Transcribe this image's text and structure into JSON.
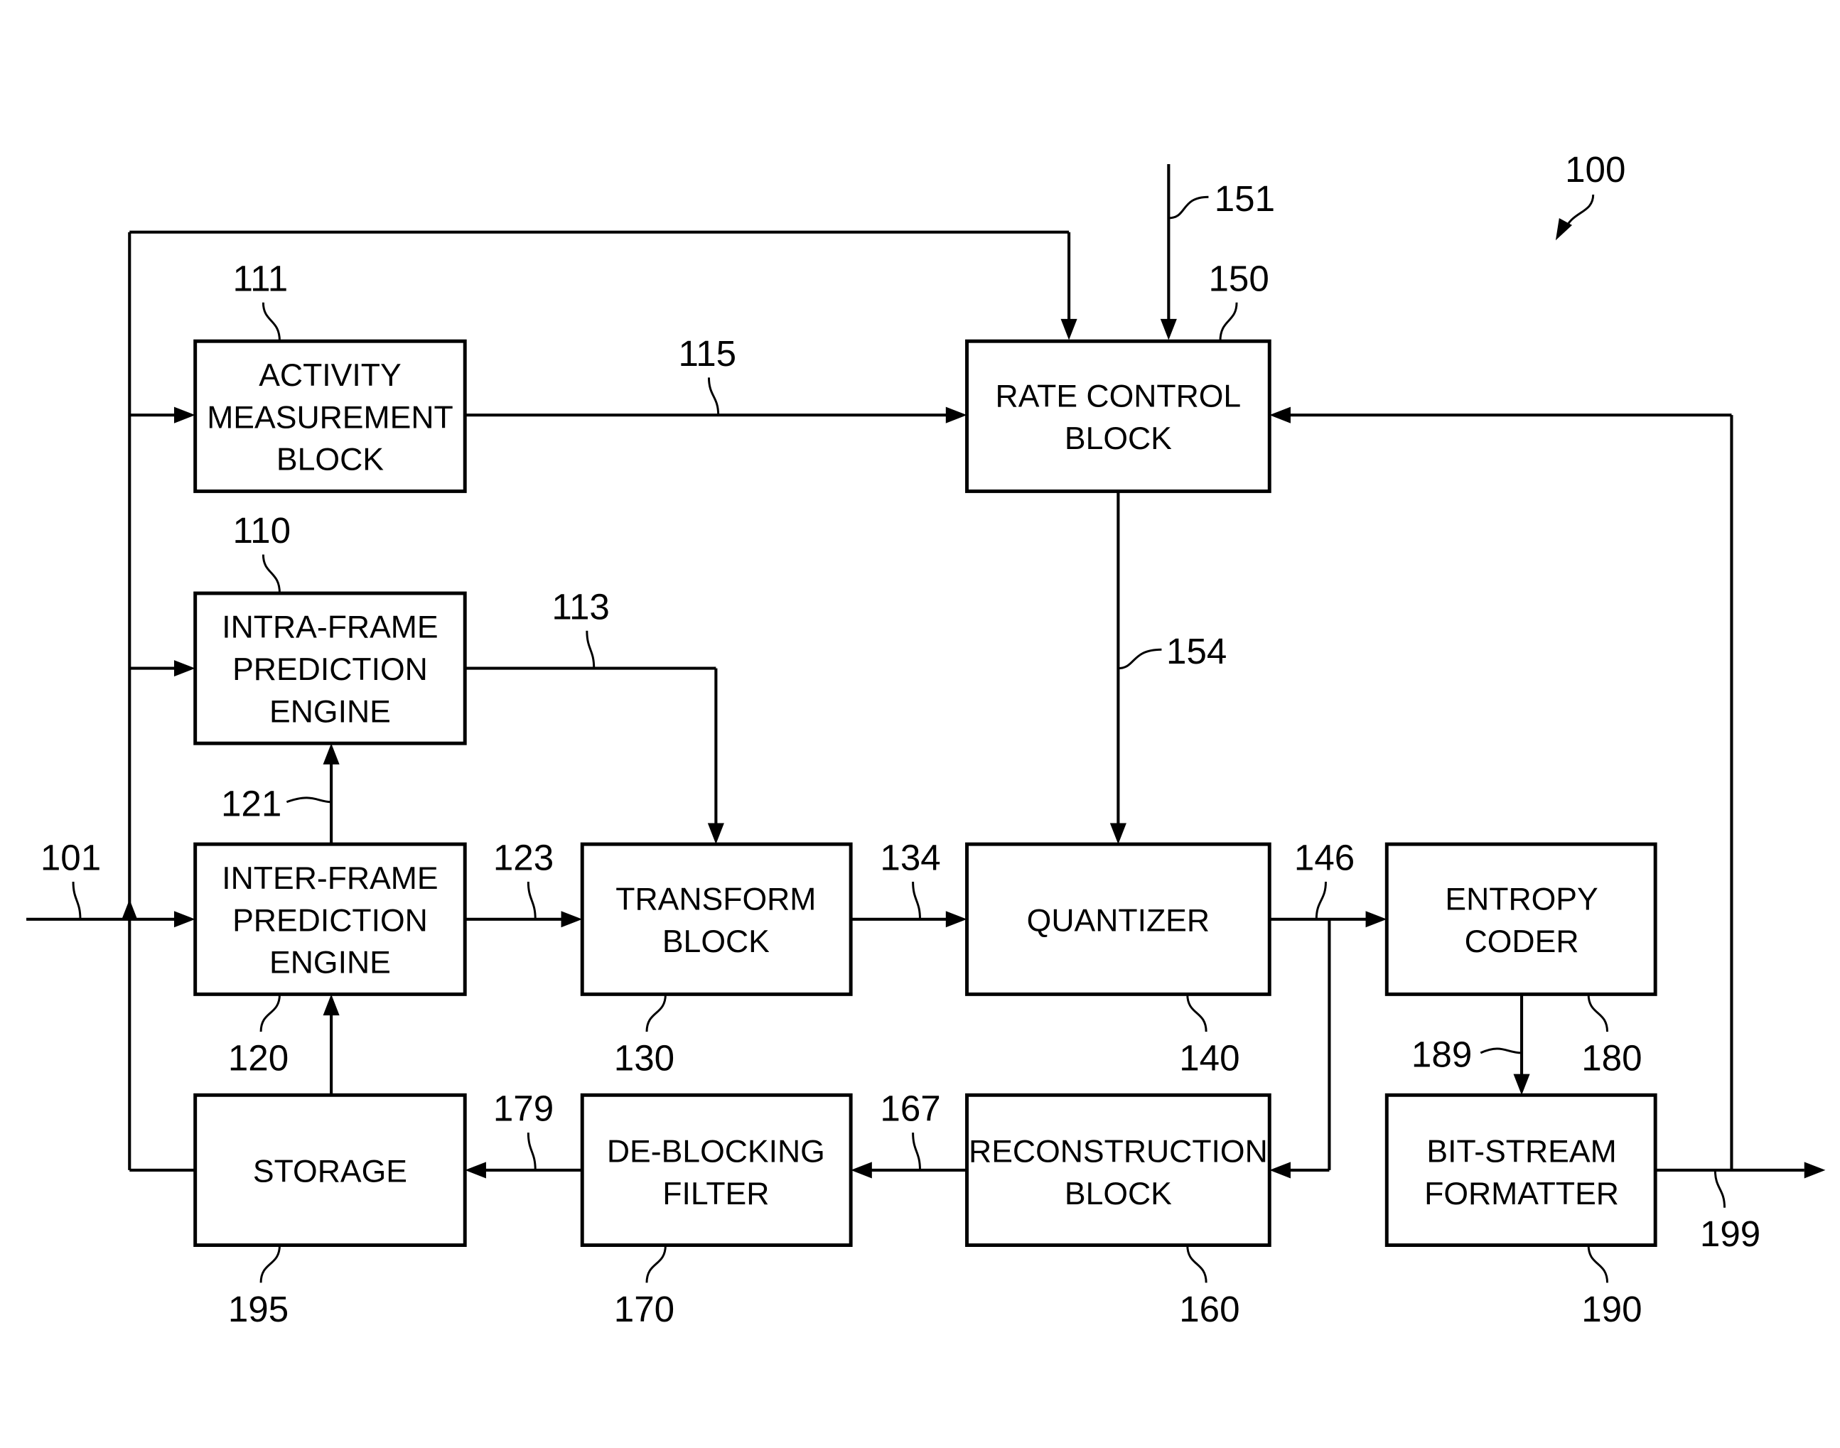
{
  "figure": {
    "ref": "100",
    "colors": {
      "line": "#000000",
      "background": "#ffffff"
    }
  },
  "blocks": {
    "activity": {
      "ref": "111",
      "lines": [
        "ACTIVITY",
        "MEASUREMENT",
        "BLOCK"
      ]
    },
    "intra": {
      "ref": "110",
      "lines": [
        "INTRA-FRAME",
        "PREDICTION",
        "ENGINE"
      ]
    },
    "inter": {
      "ref": "120",
      "lines": [
        "INTER-FRAME",
        "PREDICTION",
        "ENGINE"
      ]
    },
    "storage": {
      "ref": "195",
      "lines": [
        "STORAGE"
      ]
    },
    "transform": {
      "ref": "130",
      "lines": [
        "TRANSFORM",
        "BLOCK"
      ]
    },
    "deblock": {
      "ref": "170",
      "lines": [
        "DE-BLOCKING",
        "FILTER"
      ]
    },
    "rate": {
      "ref": "150",
      "lines": [
        "RATE CONTROL",
        "BLOCK"
      ]
    },
    "quant": {
      "ref": "140",
      "lines": [
        "QUANTIZER"
      ]
    },
    "recon": {
      "ref": "160",
      "lines": [
        "RECONSTRUCTION",
        "BLOCK"
      ]
    },
    "entropy": {
      "ref": "180",
      "lines": [
        "ENTROPY",
        "CODER"
      ]
    },
    "bitstream": {
      "ref": "190",
      "lines": [
        "BIT-STREAM",
        "FORMATTER"
      ]
    }
  },
  "signals": {
    "s101": "101",
    "s113": "113",
    "s115": "115",
    "s121": "121",
    "s123": "123",
    "s134": "134",
    "s146": "146",
    "s151": "151",
    "s154": "154",
    "s167": "167",
    "s179": "179",
    "s189": "189",
    "s199": "199"
  }
}
